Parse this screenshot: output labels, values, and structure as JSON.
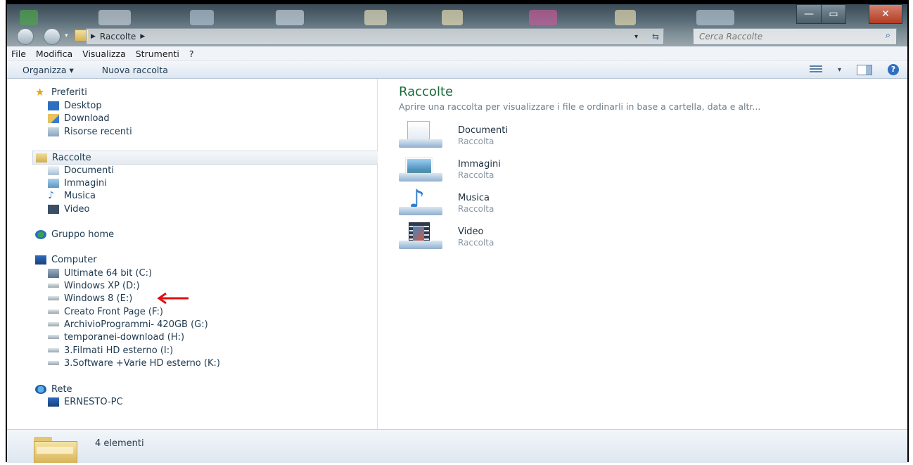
{
  "window": {
    "address_crumb": "Raccolte",
    "search_placeholder": "Cerca Raccolte",
    "minimize": "—",
    "maximize": "▭",
    "close": "✕"
  },
  "menu": [
    "File",
    "Modifica",
    "Visualizza",
    "Strumenti",
    "?"
  ],
  "commands": {
    "organize": "Organizza ▾",
    "new_library": "Nuova raccolta"
  },
  "nav": {
    "favorites": {
      "label": "Preferiti",
      "items": [
        "Desktop",
        "Download",
        "Risorse recenti"
      ]
    },
    "libraries": {
      "label": "Raccolte",
      "items": [
        "Documenti",
        "Immagini",
        "Musica",
        "Video"
      ]
    },
    "homegroup": "Gruppo home",
    "computer": {
      "label": "Computer",
      "drives": [
        "Ultimate 64 bit (C:)",
        "Windows XP (D:)",
        "Windows 8 (E:)",
        "Creato Front Page (F:)",
        "ArchivioProgrammi- 420GB (G:)",
        "temporanei-download (H:)",
        "3.Filmati HD esterno (I:)",
        "3.Software +Varie HD esterno (K:)"
      ]
    },
    "network": {
      "label": "Rete",
      "items": [
        "ERNESTO-PC"
      ]
    }
  },
  "content": {
    "title": "Raccolte",
    "subtitle": "Aprire una raccolta per visualizzare i file e ordinarli in base a cartella, data e altr...",
    "libraries": [
      {
        "name": "Documenti",
        "type": "Raccolta",
        "icon": "documents-library-icon"
      },
      {
        "name": "Immagini",
        "type": "Raccolta",
        "icon": "pictures-library-icon"
      },
      {
        "name": "Musica",
        "type": "Raccolta",
        "icon": "music-library-icon"
      },
      {
        "name": "Video",
        "type": "Raccolta",
        "icon": "video-library-icon"
      }
    ]
  },
  "status": {
    "count": "4 elementi"
  },
  "colors": {
    "heading_green": "#1a6a3a",
    "nav_text": "#1e3950",
    "annotation_arrow": "#e01010"
  }
}
